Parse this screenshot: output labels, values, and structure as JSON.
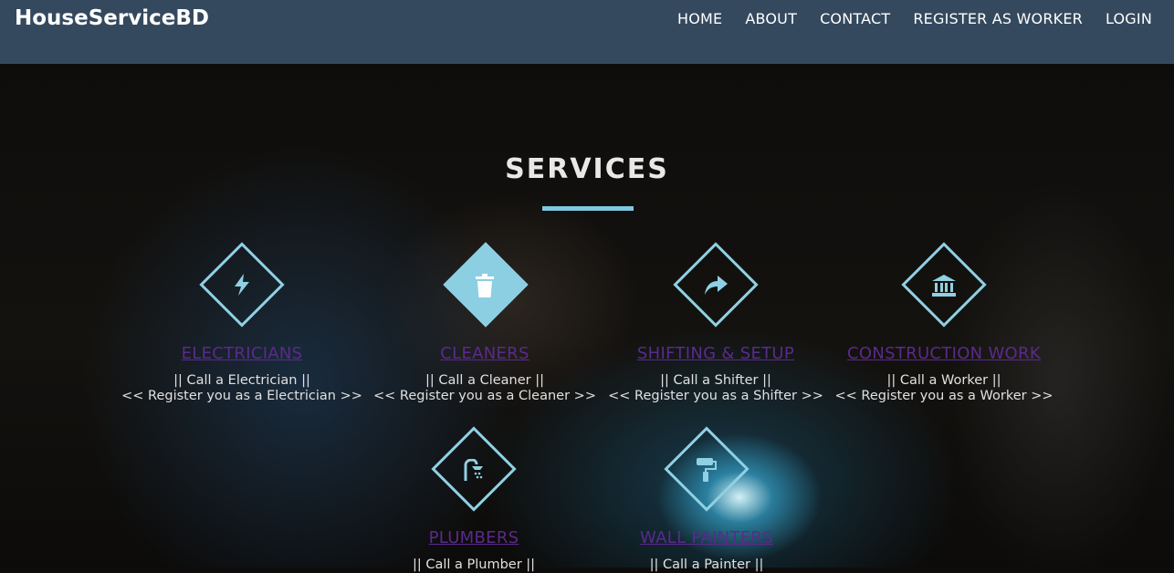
{
  "navbar": {
    "brand": "HouseServiceBD",
    "links": [
      "HOME",
      "ABOUT",
      "CONTACT",
      "REGISTER AS WORKER",
      "LOGIN"
    ]
  },
  "section": {
    "title": "SERVICES"
  },
  "services": [
    {
      "name": "ELECTRICIANS",
      "line1": "|| Call a Electrician ||",
      "line2": "<< Register you as a Electrician >>",
      "icon": "lightning-bolt-icon"
    },
    {
      "name": "CLEANERS",
      "line1": "|| Call a Cleaner ||",
      "line2": "<< Register you as a Cleaner >>",
      "icon": "trash-icon"
    },
    {
      "name": "SHIFTING & SETUP",
      "line1": "|| Call a Shifter ||",
      "line2": "<< Register you as a Shifter >>",
      "icon": "share-arrow-icon"
    },
    {
      "name": "CONSTRUCTION WORK",
      "line1": "|| Call a Worker ||",
      "line2": "<< Register you as a Worker >>",
      "icon": "bank-building-icon"
    },
    {
      "name": "PLUMBERS",
      "line1": "|| Call a Plumber ||",
      "line2": "",
      "icon": "shower-icon"
    },
    {
      "name": "WALL PAINTERS",
      "line1": "|| Call a Painter ||",
      "line2": "",
      "icon": "paint-roller-icon"
    }
  ],
  "colors": {
    "navbar": "#34495e",
    "accent": "#8ccfe3",
    "link": "#5a2a8c"
  }
}
